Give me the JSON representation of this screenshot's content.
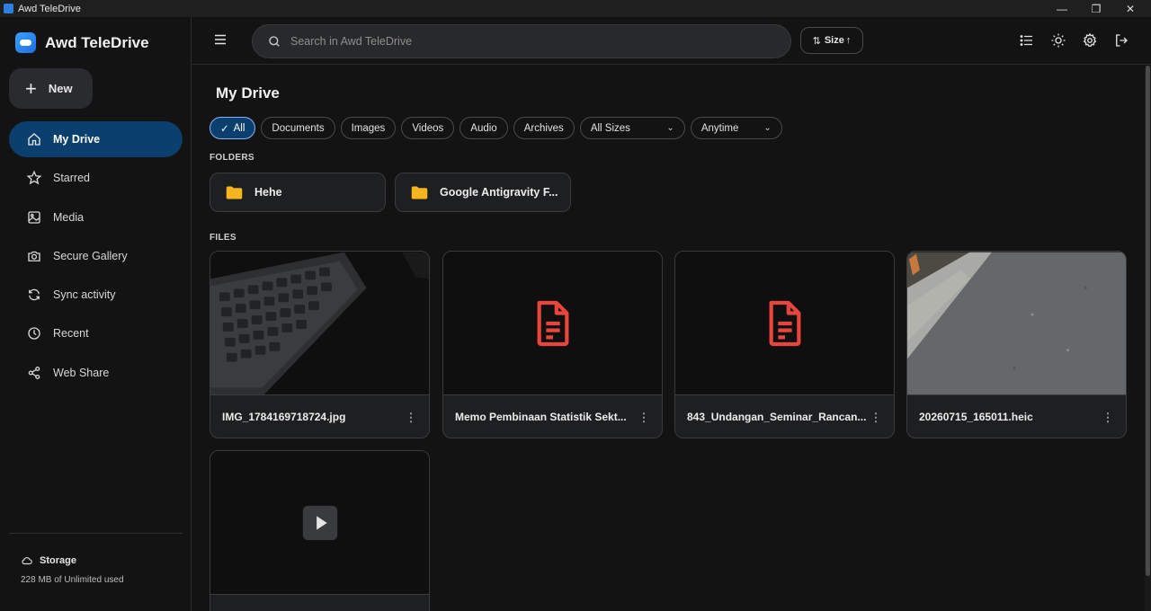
{
  "window": {
    "title": "Awd TeleDrive"
  },
  "brand": {
    "name": "Awd TeleDrive"
  },
  "sidebar": {
    "new_label": "New",
    "items": [
      {
        "label": "My Drive",
        "icon": "home-icon",
        "active": true
      },
      {
        "label": "Starred",
        "icon": "star-icon"
      },
      {
        "label": "Media",
        "icon": "image-icon"
      },
      {
        "label": "Secure Gallery",
        "icon": "camera-icon"
      },
      {
        "label": "Sync activity",
        "icon": "sync-icon"
      },
      {
        "label": "Recent",
        "icon": "clock-icon"
      },
      {
        "label": "Web Share",
        "icon": "share-icon"
      }
    ],
    "storage": {
      "title": "Storage",
      "used": "228 MB of Unlimited used"
    }
  },
  "search": {
    "placeholder": "Search in Awd TeleDrive"
  },
  "sort": {
    "label": "Size"
  },
  "main": {
    "title": "My Drive",
    "filters": {
      "chips": [
        "All",
        "Documents",
        "Images",
        "Videos",
        "Audio",
        "Archives"
      ],
      "active": "All",
      "size_select": "All Sizes",
      "time_select": "Anytime"
    },
    "folders_label": "FOLDERS",
    "folders": [
      "Hehe",
      "Google Antigravity F..."
    ],
    "files_label": "FILES",
    "files": [
      {
        "name": "IMG_1784169718724.jpg",
        "kind": "image"
      },
      {
        "name": "Memo Pembinaan Statistik Sekt...",
        "kind": "document"
      },
      {
        "name": "843_Undangan_Seminar_Rancan...",
        "kind": "document"
      },
      {
        "name": "20260715_165011.heic",
        "kind": "image"
      },
      {
        "name": "",
        "kind": "video"
      }
    ]
  },
  "colors": {
    "accent": "#0b3f6e",
    "doc_icon": "#e8453c",
    "folder": "#f6b51e"
  }
}
